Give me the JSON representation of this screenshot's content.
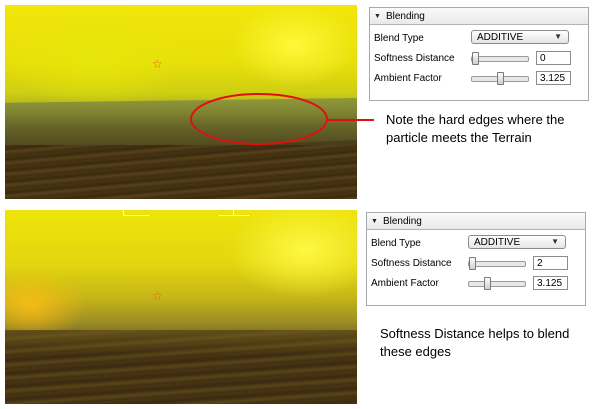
{
  "top_example": {
    "panel": {
      "header": "Blending",
      "blend_type_label": "Blend Type",
      "blend_type_value": "ADDITIVE",
      "softness_label": "Softness Distance",
      "softness_value": "0",
      "softness_level": 0.0,
      "ambient_label": "Ambient Factor",
      "ambient_value": "3.125",
      "ambient_level": 0.5
    },
    "note": "Note the hard edges where the particle meets the Terrain"
  },
  "bottom_example": {
    "panel": {
      "header": "Blending",
      "blend_type_label": "Blend Type",
      "blend_type_value": "ADDITIVE",
      "softness_label": "Softness Distance",
      "softness_value": "2",
      "softness_level": 0.0,
      "ambient_label": "Ambient Factor",
      "ambient_value": "3.125",
      "ambient_level": 0.3
    },
    "note": "Softness Distance helps to blend these edges"
  },
  "colors": {
    "callout": "#e01010",
    "marker": "#d66a10"
  },
  "icons": {
    "collapse": "caret-down-icon",
    "dropdown": "chevron-down-icon",
    "marker": "star-icon"
  }
}
